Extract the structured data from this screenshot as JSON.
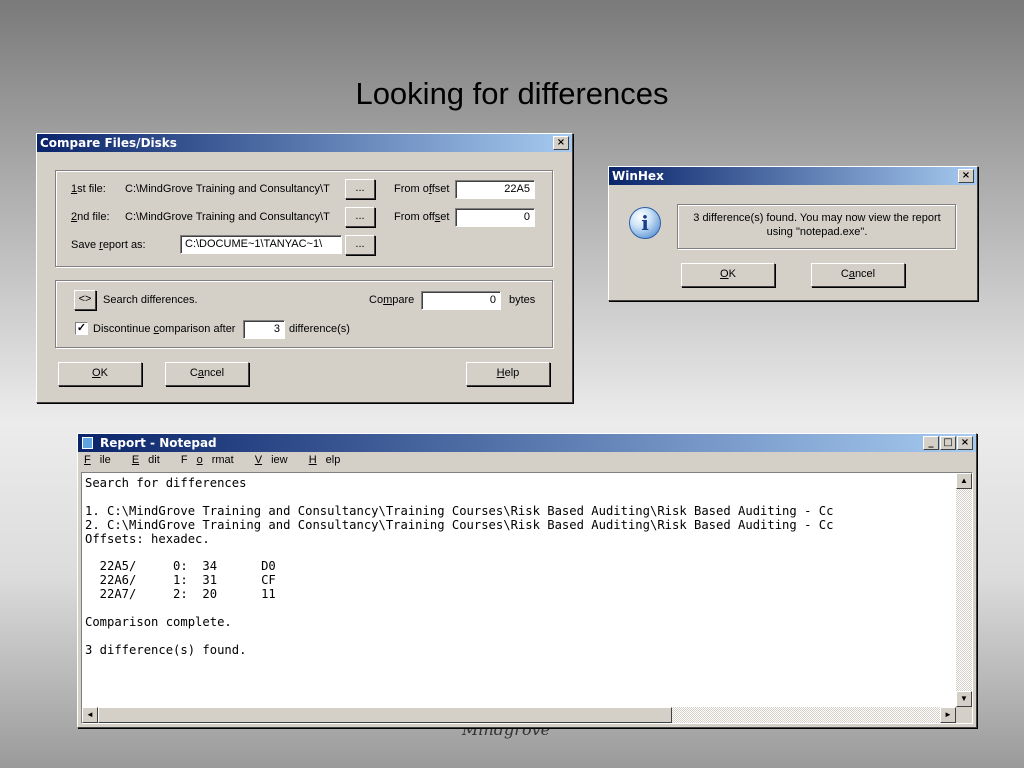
{
  "slide": {
    "title": "Looking for differences",
    "footer": "Mindgrove"
  },
  "compare_dialog": {
    "title": "Compare Files/Disks",
    "close_glyph": "×",
    "file1_label_underline": "1",
    "file1_label_rest": "st file:",
    "file1_path": "C:\\MindGrove Training and Consultancy\\T",
    "file2_label_underline": "2",
    "file2_label_rest": "nd file:",
    "file2_path": "C:\\MindGrove Training and Consultancy\\T",
    "browse_label": "...",
    "offset1_label_pre": "From o",
    "offset1_label_u": "f",
    "offset1_label_post": "fset",
    "offset1_value": "22A5",
    "offset2_label_pre": "From off",
    "offset2_label_u": "s",
    "offset2_label_post": "et",
    "offset2_value": "0",
    "save_label_pre": "Save ",
    "save_label_u": "r",
    "save_label_post": "eport as:",
    "save_path": "C:\\DOCUME~1\\TANYAC~1\\",
    "mode_glyph": "<>",
    "mode_label": "Search differences.",
    "compare_label_pre": "Co",
    "compare_label_u": "m",
    "compare_label_post": "pare",
    "compare_value": "0",
    "bytes_label": "bytes",
    "discontinue_checked_glyph": "✓",
    "discontinue_pre": "Discontinue ",
    "discontinue_u": "c",
    "discontinue_post": "omparison after",
    "discontinue_value": "3",
    "difference_label": "difference(s)",
    "ok_u": "O",
    "ok_rest": "K",
    "cancel_pre": "C",
    "cancel_u": "a",
    "cancel_post": "ncel",
    "help_u": "H",
    "help_rest": "elp"
  },
  "winhex_dialog": {
    "title": "WinHex",
    "close_glyph": "×",
    "info_glyph": "i",
    "message": "3 difference(s) found. You may now view the report using \"notepad.exe\".",
    "ok_u": "O",
    "ok_rest": "K",
    "cancel_pre": "C",
    "cancel_u": "a",
    "cancel_post": "ncel"
  },
  "notepad": {
    "title": "Report - Notepad",
    "min_glyph": "_",
    "max_glyph": "□",
    "close_glyph": "×",
    "menu": [
      {
        "u": "F",
        "rest": "ile"
      },
      {
        "u": "E",
        "rest": "dit"
      },
      {
        "pre": "F",
        "u": "o",
        "rest": "rmat"
      },
      {
        "u": "V",
        "rest": "iew"
      },
      {
        "u": "H",
        "rest": "elp"
      }
    ],
    "content": "Search for differences\n\n1. C:\\MindGrove Training and Consultancy\\Training Courses\\Risk Based Auditing\\Risk Based Auditing - Cc\n2. C:\\MindGrove Training and Consultancy\\Training Courses\\Risk Based Auditing\\Risk Based Auditing - Cc\nOffsets: hexadec.\n\n  22A5/     0:  34      D0\n  22A6/     1:  31      CF\n  22A7/     2:  20      11\n\nComparison complete.\n\n3 difference(s) found.",
    "scroll_up_glyph": "▲",
    "scroll_down_glyph": "▼",
    "scroll_left_glyph": "◄",
    "scroll_right_glyph": "►"
  }
}
